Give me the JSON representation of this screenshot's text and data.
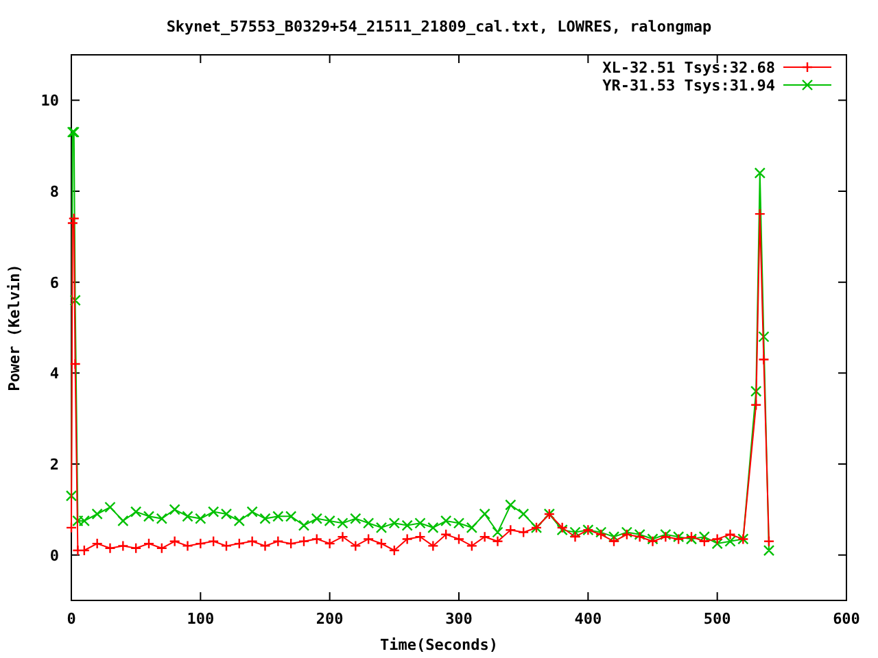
{
  "chart_data": {
    "type": "line",
    "title": "Skynet_57553_B0329+54_21511_21809_cal.txt, LOWRES, ralongmap",
    "xlabel": "Time(Seconds)",
    "ylabel": "Power (Kelvin)",
    "x": [
      0,
      1,
      2,
      3,
      5,
      10,
      20,
      30,
      40,
      50,
      60,
      70,
      80,
      90,
      100,
      110,
      120,
      130,
      140,
      150,
      160,
      170,
      180,
      190,
      200,
      210,
      220,
      230,
      240,
      250,
      260,
      270,
      280,
      290,
      300,
      310,
      320,
      330,
      340,
      350,
      360,
      370,
      380,
      390,
      400,
      410,
      420,
      430,
      440,
      450,
      460,
      470,
      480,
      490,
      500,
      510,
      520,
      530,
      533,
      536,
      540
    ],
    "series": [
      {
        "name": "XL-32.51 Tsys:32.68",
        "color": "#ff0000",
        "marker": "plus",
        "values": [
          0.6,
          7.3,
          7.4,
          4.2,
          0.1,
          0.1,
          0.25,
          0.15,
          0.2,
          0.15,
          0.25,
          0.15,
          0.3,
          0.2,
          0.25,
          0.3,
          0.2,
          0.25,
          0.3,
          0.2,
          0.3,
          0.25,
          0.3,
          0.35,
          0.25,
          0.4,
          0.2,
          0.35,
          0.25,
          0.1,
          0.35,
          0.4,
          0.2,
          0.45,
          0.35,
          0.2,
          0.4,
          0.3,
          0.55,
          0.5,
          0.6,
          0.9,
          0.6,
          0.4,
          0.55,
          0.45,
          0.3,
          0.45,
          0.4,
          0.3,
          0.4,
          0.35,
          0.4,
          0.3,
          0.35,
          0.45,
          0.35,
          3.3,
          7.5,
          4.3,
          0.3
        ]
      },
      {
        "name": "YR-31.53 Tsys:31.94",
        "color": "#00c000",
        "marker": "cross",
        "values": [
          1.3,
          9.3,
          9.3,
          5.6,
          0.75,
          0.75,
          0.9,
          1.05,
          0.75,
          0.95,
          0.85,
          0.8,
          1.0,
          0.85,
          0.8,
          0.95,
          0.9,
          0.75,
          0.95,
          0.8,
          0.85,
          0.85,
          0.65,
          0.8,
          0.75,
          0.7,
          0.8,
          0.7,
          0.6,
          0.7,
          0.65,
          0.7,
          0.6,
          0.75,
          0.7,
          0.6,
          0.9,
          0.5,
          1.1,
          0.9,
          0.6,
          0.9,
          0.55,
          0.5,
          0.55,
          0.5,
          0.4,
          0.5,
          0.45,
          0.35,
          0.45,
          0.4,
          0.35,
          0.4,
          0.25,
          0.3,
          0.35,
          3.6,
          8.4,
          4.8,
          0.1
        ]
      }
    ],
    "legend": true,
    "xlim": [
      0,
      600
    ],
    "ylim": [
      -1,
      11
    ],
    "xticks": [
      0,
      100,
      200,
      300,
      400,
      500,
      600
    ],
    "yticks": [
      0,
      2,
      4,
      6,
      8,
      10
    ]
  }
}
